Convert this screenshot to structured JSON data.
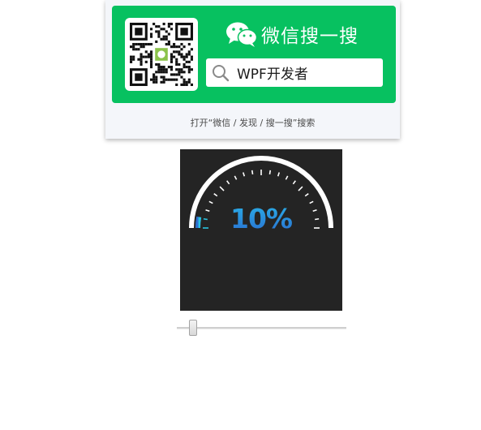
{
  "wechat_card": {
    "brand_title": "微信搜一搜",
    "search_query": "WPF开发者",
    "hint": "打开“微信 / 发现 / 搜一搜”搜索",
    "accent_color": "#07c160",
    "icons": [
      "qr-code",
      "wechat-logo",
      "search-icon"
    ]
  },
  "gauge": {
    "value_text": "10%",
    "value": 10,
    "max": 100,
    "tick_count": 20,
    "colors": {
      "background": "#242424",
      "arc": "#ffffff",
      "progress_start": "#2e6fd0",
      "progress_end": "#2ac3e0",
      "text": "#2e8ee0"
    }
  },
  "slider": {
    "value": 10,
    "min": 0,
    "max": 100
  }
}
